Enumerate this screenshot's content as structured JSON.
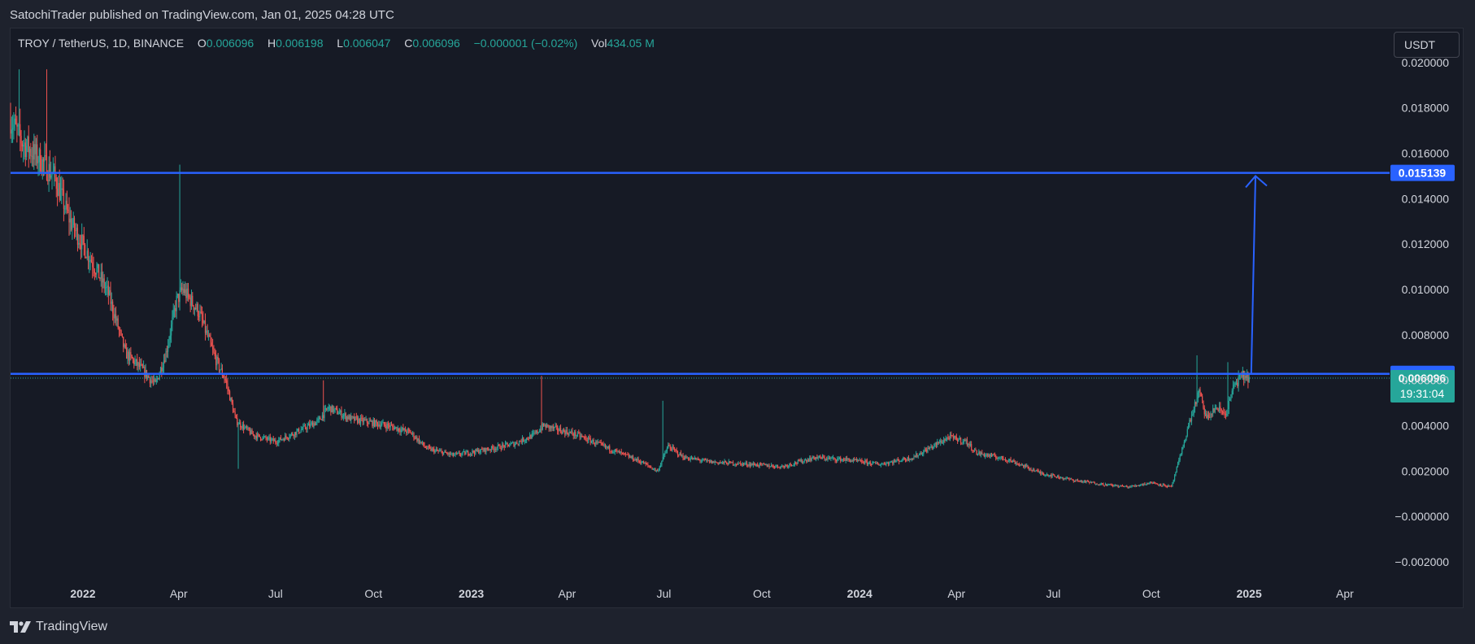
{
  "header": {
    "publisher_text": "SatochiTrader published on TradingView.com, Jan 01, 2025 04:28 UTC"
  },
  "legend": {
    "symbol": "TROY / TetherUS, 1D, BINANCE",
    "open_label": "O",
    "open": "0.006096",
    "high_label": "H",
    "high": "0.006198",
    "low_label": "L",
    "low": "0.006047",
    "close_label": "C",
    "close": "0.006096",
    "change": "−0.000001 (−0.02%)",
    "vol_label": "Vol",
    "vol": "434.05 M"
  },
  "currency_button": "USDT",
  "footer": {
    "brand": "TradingView"
  },
  "colors": {
    "up": "#26a69a",
    "down": "#ef5350",
    "line": "#2962ff",
    "grid": "#2a2e39",
    "bg": "#161a25",
    "text": "#d1d4dc"
  },
  "chart_data": {
    "type": "candlestick",
    "symbol": "TROY / TetherUS",
    "interval": "1D",
    "exchange": "BINANCE",
    "ylim": [
      -0.0025,
      0.0215
    ],
    "y_ticks": [
      "0.020000",
      "0.018000",
      "0.016000",
      "0.014000",
      "0.012000",
      "0.010000",
      "0.008000",
      "0.006000",
      "0.004000",
      "0.002000",
      "−0.000000",
      "−0.002000"
    ],
    "y_tick_values": [
      0.02,
      0.018,
      0.016,
      0.014,
      0.012,
      0.01,
      0.008,
      0.006,
      0.004,
      0.002,
      0.0,
      -0.002
    ],
    "x_range": [
      "2021-10-25",
      "2025-05-10"
    ],
    "x_ticks": [
      {
        "label": "2022",
        "date": "2022-01-01",
        "bold": true
      },
      {
        "label": "Apr",
        "date": "2022-04-01"
      },
      {
        "label": "Jul",
        "date": "2022-07-01"
      },
      {
        "label": "Oct",
        "date": "2022-10-01"
      },
      {
        "label": "2023",
        "date": "2023-01-01",
        "bold": true
      },
      {
        "label": "Apr",
        "date": "2023-04-01"
      },
      {
        "label": "Jul",
        "date": "2023-07-01"
      },
      {
        "label": "Oct",
        "date": "2023-10-01"
      },
      {
        "label": "2024",
        "date": "2024-01-01",
        "bold": true
      },
      {
        "label": "Apr",
        "date": "2024-04-01"
      },
      {
        "label": "Jul",
        "date": "2024-07-01"
      },
      {
        "label": "Oct",
        "date": "2024-10-01"
      },
      {
        "label": "2025",
        "date": "2025-01-01",
        "bold": true
      },
      {
        "label": "Apr",
        "date": "2025-04-01"
      }
    ],
    "price_path": [
      [
        "2021-10-25",
        0.0175
      ],
      [
        "2021-11-05",
        0.0165
      ],
      [
        "2021-11-20",
        0.0158
      ],
      [
        "2021-12-05",
        0.015
      ],
      [
        "2021-12-20",
        0.013
      ],
      [
        "2022-01-10",
        0.0112
      ],
      [
        "2022-01-25",
        0.0098
      ],
      [
        "2022-02-10",
        0.0072
      ],
      [
        "2022-02-25",
        0.0065
      ],
      [
        "2022-03-10",
        0.0058
      ],
      [
        "2022-03-20",
        0.0072
      ],
      [
        "2022-03-30",
        0.0095
      ],
      [
        "2022-04-05",
        0.01
      ],
      [
        "2022-04-20",
        0.009
      ],
      [
        "2022-05-05",
        0.007
      ],
      [
        "2022-05-15",
        0.006
      ],
      [
        "2022-05-25",
        0.0042
      ],
      [
        "2022-06-10",
        0.0036
      ],
      [
        "2022-07-01",
        0.0033
      ],
      [
        "2022-07-20",
        0.0037
      ],
      [
        "2022-08-10",
        0.0042
      ],
      [
        "2022-08-20",
        0.0048
      ],
      [
        "2022-09-10",
        0.0043
      ],
      [
        "2022-10-15",
        0.004
      ],
      [
        "2022-11-05",
        0.0037
      ],
      [
        "2022-11-20",
        0.003
      ],
      [
        "2022-12-15",
        0.0027
      ],
      [
        "2023-01-10",
        0.0029
      ],
      [
        "2023-02-10",
        0.0032
      ],
      [
        "2023-03-01",
        0.0036
      ],
      [
        "2023-03-10",
        0.004
      ],
      [
        "2023-04-10",
        0.0036
      ],
      [
        "2023-05-10",
        0.003
      ],
      [
        "2023-06-10",
        0.0024
      ],
      [
        "2023-06-25",
        0.002
      ],
      [
        "2023-07-05",
        0.0031
      ],
      [
        "2023-07-20",
        0.0026
      ],
      [
        "2023-08-15",
        0.0024
      ],
      [
        "2023-09-20",
        0.0023
      ],
      [
        "2023-10-20",
        0.0022
      ],
      [
        "2023-11-20",
        0.0026
      ],
      [
        "2023-12-20",
        0.0025
      ],
      [
        "2024-01-20",
        0.0023
      ],
      [
        "2024-02-20",
        0.0026
      ],
      [
        "2024-03-10",
        0.0031
      ],
      [
        "2024-03-25",
        0.0035
      ],
      [
        "2024-04-10",
        0.0033
      ],
      [
        "2024-04-20",
        0.0028
      ],
      [
        "2024-05-20",
        0.0025
      ],
      [
        "2024-06-20",
        0.0019
      ],
      [
        "2024-07-20",
        0.0016
      ],
      [
        "2024-08-20",
        0.0014
      ],
      [
        "2024-09-10",
        0.0013
      ],
      [
        "2024-10-01",
        0.0015
      ],
      [
        "2024-10-20",
        0.0013
      ],
      [
        "2024-10-28",
        0.0026
      ],
      [
        "2024-11-05",
        0.004
      ],
      [
        "2024-11-15",
        0.0055
      ],
      [
        "2024-11-22",
        0.0043
      ],
      [
        "2024-12-01",
        0.0048
      ],
      [
        "2024-12-10",
        0.0045
      ],
      [
        "2024-12-18",
        0.0058
      ],
      [
        "2024-12-26",
        0.0062
      ],
      [
        "2025-01-01",
        0.0061
      ]
    ],
    "spikes": [
      {
        "date": "2021-11-02",
        "high": 0.0197
      },
      {
        "date": "2021-11-28",
        "high": 0.0197
      },
      {
        "date": "2022-04-02",
        "high": 0.0155
      },
      {
        "date": "2022-05-27",
        "low": 0.0021
      },
      {
        "date": "2022-08-15",
        "high": 0.006
      },
      {
        "date": "2023-03-08",
        "high": 0.0062
      },
      {
        "date": "2023-06-30",
        "high": 0.0051
      },
      {
        "date": "2024-11-13",
        "high": 0.0071
      },
      {
        "date": "2024-12-12",
        "high": 0.0068
      }
    ],
    "horizontal_levels": [
      {
        "value": 0.015139,
        "label": "0.015139",
        "color": "#2962ff"
      },
      {
        "value": 0.006283,
        "label": "0.006283",
        "color": "#2962ff"
      }
    ],
    "last_price": {
      "value": 0.006096,
      "label": "0.006096",
      "countdown": "19:31:04",
      "color": "#26a69a"
    },
    "projection_arrow": {
      "from_date": "2025-01-03",
      "from_value": 0.0063,
      "to_date": "2025-01-07",
      "to_value": 0.015
    }
  }
}
